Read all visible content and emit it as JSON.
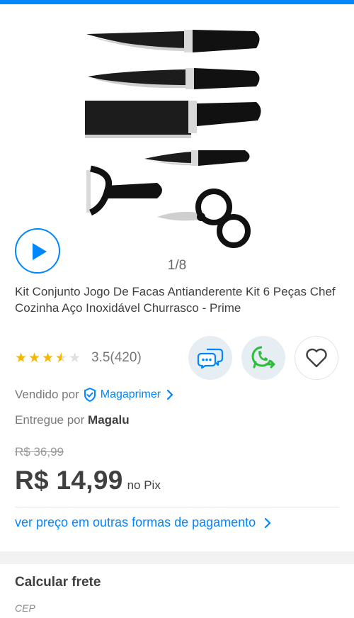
{
  "gallery": {
    "product_image_alt": "knife-set-product-image",
    "pager": "1/8",
    "play_icon": "play-icon"
  },
  "product": {
    "title": "Kit Conjunto Jogo De Facas Antianderente Kit 6 Peças Chef Cozinha Aço Inoxidável Churrasco - Prime",
    "rating": {
      "stars_value": 3.5,
      "stars_max": 5,
      "text": "3.5(420)"
    }
  },
  "actions": {
    "chat_icon": "chat-bubbles-icon",
    "whatsapp_icon": "whatsapp-share-icon",
    "favorite_icon": "heart-icon"
  },
  "seller": {
    "label": "Vendido por",
    "name": "Magaprimer",
    "verified_icon": "shield-check-icon"
  },
  "delivery": {
    "label": "Entregue por",
    "name": "Magalu"
  },
  "pricing": {
    "old_price": "R$ 36,99",
    "price": "R$ 14,99",
    "suffix": "no Pix",
    "other_payments_link": "ver preço em outras formas de pagamento"
  },
  "freight": {
    "title": "Calcular frete",
    "cep_placeholder": "CEP"
  },
  "colors": {
    "accent": "#0086ff",
    "star": "#f5b800",
    "text": "#404040",
    "whatsapp": "#2dbd3c"
  }
}
